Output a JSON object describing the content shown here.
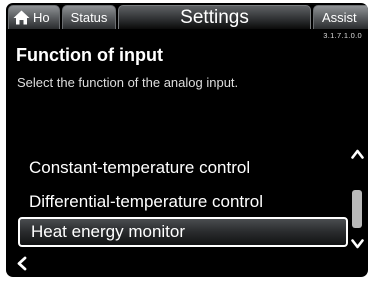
{
  "tabs": {
    "home_label": "Ho",
    "status_label": "Status",
    "settings_label": "Settings",
    "assist_label": "Assist"
  },
  "menu_code": "3.1.7.1.0.0",
  "page": {
    "title": "Function of input",
    "subtitle": "Select the function of the analog input."
  },
  "options": [
    {
      "label": "Constant-temperature control",
      "selected": false
    },
    {
      "label": "Differential-temperature control",
      "selected": false
    },
    {
      "label": "Heat energy monitor",
      "selected": true
    }
  ],
  "icons": {
    "home": "home-icon",
    "scroll_up": "chevron-up-icon",
    "scroll_down": "chevron-down-icon",
    "back": "chevron-left-icon"
  },
  "colors": {
    "background": "#000000",
    "text": "#ffffff",
    "scroll_thumb": "#b9b9b9"
  }
}
